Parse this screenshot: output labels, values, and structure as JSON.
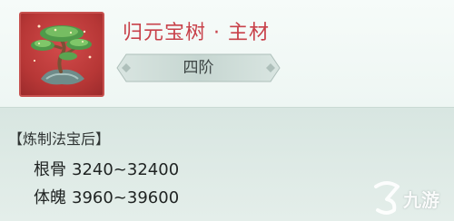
{
  "item": {
    "name": "归元宝树 · 主材",
    "tier": "四阶",
    "icon": "bonsai-tree-icon",
    "frame_color": "#c7514f"
  },
  "section": {
    "title": "【炼制法宝后】"
  },
  "stats": [
    {
      "name": "根骨",
      "value": "3240~32400"
    },
    {
      "name": "体魄",
      "value": "3960~39600"
    }
  ],
  "watermark": {
    "icon": "jiuyou-logo-icon",
    "text": "九游"
  },
  "colors": {
    "name": "#c8414a",
    "background": "#ecf4f1"
  }
}
